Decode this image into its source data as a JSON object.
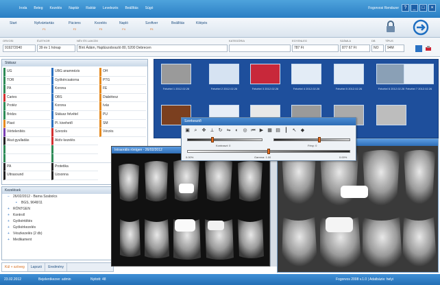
{
  "titlebar": {
    "menu": [
      "Iroda",
      "Beteg",
      "Kezelés",
      "Naptár",
      "Raktár",
      "Levelezés",
      "Beállítás",
      "Súgó"
    ],
    "brand": "Fogorvosi Rendszer",
    "win_buttons": [
      "?",
      "_",
      "□",
      "×"
    ]
  },
  "toolbar": {
    "items": [
      {
        "label": "Start",
        "sub": ""
      },
      {
        "label": "Nyilvántartás",
        "sub": "F1"
      },
      {
        "label": "Páciens",
        "sub": "F2"
      },
      {
        "label": "Kezelés",
        "sub": "F3"
      },
      {
        "label": "Napló",
        "sub": "F4"
      },
      {
        "label": "Szoftver",
        "sub": "F5"
      },
      {
        "label": "Beállítás",
        "sub": ""
      },
      {
        "label": "Kilépés",
        "sub": ""
      }
    ]
  },
  "patient": {
    "fields": [
      {
        "label": "ORVOSI",
        "value": "919272040"
      },
      {
        "label": "ÉLETKOR",
        "value": "39 év 1 hónap"
      },
      {
        "label": "NÉV ÉS LAKCÍM",
        "value": "Bíró Ádám, Hajdúszoboszló 80, 5200 Debrecen"
      },
      {
        "label": "KATEGÓRIA",
        "value": ""
      },
      {
        "label": "EGYENLEG",
        "value": "787 Ft"
      },
      {
        "label": "SZÁMLA",
        "value": "877 67 Ft"
      },
      {
        "label": "DB",
        "value": "NO"
      },
      {
        "label": "TÍPUS",
        "value": "94M"
      }
    ]
  },
  "diagnosis": {
    "header": "Státusz",
    "col1": [
      "UG",
      "TOR",
      "PA",
      "Caries",
      "Protéz",
      "Bridzs",
      "Plast",
      "Vértelenítés",
      "Akut gyulladás",
      "",
      "",
      "",
      "PA",
      "Ultrasound"
    ],
    "col2": [
      "UBG anamnézis",
      "Gyökércsatorna",
      "Korona",
      "OBS",
      "Korona",
      "Státusz felvétel",
      "Pl. kivehető",
      "Szerzés",
      "Aktív kezelés",
      "",
      "",
      "",
      "Protetika",
      "Uzsonna"
    ],
    "col3": [
      "OH",
      "PTG",
      "FE",
      "Diabétesz",
      "Ivás",
      "PU",
      "SM",
      "Vérzés",
      "",
      "",
      "",
      "",
      "",
      ""
    ]
  },
  "history": {
    "header": "Kezelések",
    "items": [
      {
        "text": "26/02/2012 - Barna Szabolcs",
        "child": false
      },
      {
        "text": "BGS, 9648/11",
        "child": true
      },
      {
        "text": "RÖNTGEN",
        "child": false
      },
      {
        "text": "Kontroll",
        "child": false
      },
      {
        "text": "Gyökértöltés",
        "child": false
      },
      {
        "text": "Gyökérkezelés",
        "child": false
      },
      {
        "text": "Vészkezelés (2 db)",
        "child": false
      },
      {
        "text": "Medikament",
        "child": false
      }
    ]
  },
  "bottom_tabs": [
    "Kül + szöveg",
    "Lapozó",
    "Eredmény"
  ],
  "gallery": {
    "thumbnails": [
      {
        "caption": "Felvétel 1 2012.02.26",
        "tone": "#9a9a9a"
      },
      {
        "caption": "Felvétel 2 2012.02.26",
        "tone": "#d6e3f2"
      },
      {
        "caption": "Felvétel 3 2012.02.26",
        "tone": "#c8283a"
      },
      {
        "caption": "Felvétel 4 2012.02.26",
        "tone": "#e3ecf6"
      },
      {
        "caption": "Felvétel 5 2012.02.26",
        "tone": "#e3ecf6"
      },
      {
        "caption": "Felvétel 6 2012.02.26",
        "tone": "#8aa0b6"
      },
      {
        "caption": "Felvétel 7 2012.02.26",
        "tone": "#e3ecf6"
      }
    ],
    "row2_tones": [
      "#7b3f1f",
      "#e7eef7",
      "#e8e8e8",
      "#9a9a9a",
      "#aaaaaa",
      "#bdbdbd"
    ]
  },
  "editor": {
    "title": "Szerkesztő",
    "slider_labels": [
      "Kontraszt: 0",
      "Fény: 0",
      "0.00%",
      "Gamma: 1.00",
      "0.00%"
    ],
    "levels": {
      "contrast": 0.33,
      "brightness": 0.6,
      "gamma": 0.5
    }
  },
  "viewers": {
    "left_title": "Intraorális röntgen - 26/02/2012",
    "right_title": "Intraorális röntgen - részlet"
  },
  "statusbar": {
    "date": "23.02.2012",
    "user": "Bejelentkezve: admin",
    "record": "Nyitott: 48",
    "version": "Fogorvos 2008 v.1.0 | Adatbázis: helyi"
  },
  "colors": {
    "titlebar": "#2a7ec4",
    "gallery_bg": "#1e4f9c",
    "accent_orange": "#e07020"
  }
}
